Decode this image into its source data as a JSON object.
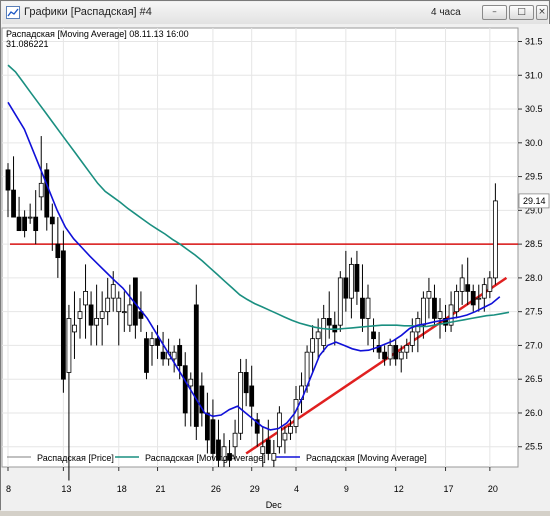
{
  "window": {
    "title": "Графики [Распадская] #4",
    "timeframe": "4 часа",
    "buttons": {
      "minimize": "–",
      "maximize": "□",
      "close": "×"
    }
  },
  "chart_info": {
    "header": "Распадская [Moving Average] 08.11.13 16:00",
    "value": "31.086221",
    "last_price": "29.14"
  },
  "legend": {
    "items": [
      {
        "label": "Распадская [Price]",
        "color": "#808080"
      },
      {
        "label": "Распадская [Moving Average]",
        "color": "#1a8f80"
      },
      {
        "label": "Распадская [Moving Average]",
        "color": "#1010d8"
      }
    ]
  },
  "chart_data": {
    "type": "candlestick",
    "x_tick_labels": [
      "8",
      "13",
      "18",
      "21",
      "26",
      "29",
      "4",
      "9",
      "12",
      "17",
      "20"
    ],
    "x_sublabel": "Dec",
    "ylim": [
      25.2,
      31.7
    ],
    "y_ticks": [
      25.5,
      26.0,
      26.5,
      27.0,
      27.5,
      28.0,
      28.5,
      29.0,
      29.5,
      30.0,
      30.5,
      31.0,
      31.5
    ],
    "horizontal_line": 28.5,
    "colors": {
      "up": "#ffffff",
      "down": "#000000",
      "ma_slow": "#1a8f80",
      "ma_fast": "#1010d8",
      "hline": "#d81010",
      "trendline": "#e02020"
    },
    "candles": [
      [
        29.6,
        29.7,
        28.9,
        29.3
      ],
      [
        29.3,
        29.8,
        28.9,
        28.9
      ],
      [
        28.9,
        29.2,
        28.8,
        28.7
      ],
      [
        28.9,
        29.0,
        28.6,
        28.7
      ],
      [
        28.9,
        29.1,
        28.8,
        28.9
      ],
      [
        28.9,
        29.3,
        28.5,
        28.7
      ],
      [
        29.2,
        30.1,
        29.0,
        29.4
      ],
      [
        29.6,
        29.7,
        28.7,
        28.9
      ],
      [
        28.9,
        29.1,
        28.4,
        28.8
      ],
      [
        28.5,
        28.9,
        28.0,
        28.3
      ],
      [
        28.4,
        28.7,
        26.3,
        26.5
      ],
      [
        26.6,
        27.6,
        25.0,
        27.4
      ],
      [
        27.2,
        27.8,
        26.8,
        27.3
      ],
      [
        27.4,
        27.7,
        27.1,
        27.5
      ],
      [
        27.6,
        28.2,
        27.1,
        27.8
      ],
      [
        27.6,
        27.8,
        27.0,
        27.3
      ],
      [
        27.3,
        27.9,
        27.0,
        27.4
      ],
      [
        27.4,
        27.8,
        27.0,
        27.5
      ],
      [
        27.5,
        28.0,
        27.3,
        27.7
      ],
      [
        27.7,
        28.1,
        27.5,
        27.9
      ],
      [
        27.5,
        27.8,
        27.0,
        27.7
      ],
      [
        27.5,
        27.8,
        27.2,
        27.5
      ],
      [
        27.3,
        27.9,
        27.2,
        27.6
      ],
      [
        28.0,
        28.0,
        27.1,
        27.3
      ],
      [
        27.5,
        27.8,
        27.2,
        27.4
      ],
      [
        27.1,
        27.2,
        26.5,
        26.6
      ],
      [
        27.0,
        27.2,
        26.7,
        27.1
      ],
      [
        27.1,
        27.3,
        26.8,
        27.0
      ],
      [
        26.9,
        27.2,
        26.7,
        26.8
      ],
      [
        26.8,
        27.1,
        26.7,
        26.9
      ],
      [
        26.8,
        27.0,
        26.6,
        26.9
      ],
      [
        27.0,
        27.1,
        26.5,
        26.7
      ],
      [
        26.7,
        26.9,
        25.8,
        26.0
      ],
      [
        26.4,
        26.6,
        25.8,
        26.5
      ],
      [
        27.6,
        27.9,
        25.6,
        25.8
      ],
      [
        26.4,
        26.6,
        25.8,
        26.0
      ],
      [
        26.0,
        26.3,
        25.4,
        25.6
      ],
      [
        25.9,
        26.2,
        25.3,
        25.4
      ],
      [
        25.6,
        25.9,
        25.2,
        25.3
      ],
      [
        25.3,
        25.7,
        25.2,
        25.5
      ],
      [
        25.4,
        25.6,
        25.2,
        25.3
      ],
      [
        25.5,
        25.9,
        25.3,
        25.7
      ],
      [
        25.7,
        26.8,
        25.6,
        26.6
      ],
      [
        26.6,
        26.8,
        26.1,
        26.3
      ],
      [
        26.4,
        26.7,
        25.8,
        26.1
      ],
      [
        25.9,
        26.0,
        25.5,
        25.7
      ],
      [
        25.4,
        25.8,
        25.2,
        25.5
      ],
      [
        25.6,
        25.9,
        25.3,
        25.4
      ],
      [
        25.3,
        25.6,
        25.2,
        25.4
      ],
      [
        25.5,
        26.1,
        25.4,
        26.0
      ],
      [
        25.6,
        25.8,
        25.4,
        25.7
      ],
      [
        25.7,
        25.9,
        25.6,
        25.8
      ],
      [
        25.8,
        26.4,
        25.7,
        26.2
      ],
      [
        26.2,
        26.6,
        26.0,
        26.4
      ],
      [
        26.4,
        27.0,
        26.3,
        26.9
      ],
      [
        26.9,
        27.3,
        26.6,
        27.1
      ],
      [
        27.1,
        27.4,
        26.8,
        27.2
      ],
      [
        27.0,
        27.6,
        26.9,
        27.4
      ],
      [
        27.4,
        27.8,
        27.1,
        27.3
      ],
      [
        27.3,
        27.5,
        27.0,
        27.2
      ],
      [
        27.3,
        28.1,
        27.2,
        28.0
      ],
      [
        28.0,
        28.4,
        27.5,
        27.7
      ],
      [
        27.7,
        28.3,
        27.4,
        28.2
      ],
      [
        28.2,
        28.4,
        27.6,
        27.8
      ],
      [
        27.7,
        28.2,
        27.2,
        27.4
      ],
      [
        27.4,
        27.9,
        27.0,
        27.7
      ],
      [
        27.2,
        27.4,
        26.9,
        27.1
      ],
      [
        27.0,
        27.2,
        26.8,
        26.9
      ],
      [
        26.9,
        27.0,
        26.7,
        26.8
      ],
      [
        26.8,
        27.1,
        26.7,
        27.0
      ],
      [
        27.0,
        27.1,
        26.7,
        26.8
      ],
      [
        26.8,
        27.0,
        26.6,
        26.9
      ],
      [
        26.9,
        27.1,
        26.8,
        27.0
      ],
      [
        27.0,
        27.4,
        26.9,
        27.2
      ],
      [
        27.2,
        27.5,
        26.9,
        27.4
      ],
      [
        27.3,
        27.8,
        27.1,
        27.7
      ],
      [
        27.7,
        28.0,
        27.4,
        27.8
      ],
      [
        27.7,
        27.9,
        27.3,
        27.4
      ],
      [
        27.4,
        27.7,
        27.1,
        27.5
      ],
      [
        27.4,
        27.6,
        27.2,
        27.3
      ],
      [
        27.3,
        27.8,
        27.2,
        27.6
      ],
      [
        27.5,
        27.9,
        27.4,
        27.8
      ],
      [
        27.8,
        28.2,
        27.6,
        28.0
      ],
      [
        27.9,
        28.3,
        27.6,
        27.8
      ],
      [
        27.8,
        27.9,
        27.5,
        27.6
      ],
      [
        27.7,
        27.9,
        27.5,
        27.7
      ],
      [
        27.7,
        28.0,
        27.5,
        27.9
      ],
      [
        27.8,
        28.1,
        27.7,
        28.0
      ],
      [
        28.0,
        29.4,
        27.9,
        29.14
      ]
    ],
    "ma_slow": [
      [
        0,
        31.15
      ],
      [
        1,
        31.05
      ],
      [
        2,
        30.9
      ],
      [
        3,
        30.75
      ],
      [
        4,
        30.6
      ],
      [
        5,
        30.45
      ],
      [
        6,
        30.3
      ],
      [
        7,
        30.15
      ],
      [
        8,
        30.0
      ],
      [
        9,
        29.85
      ],
      [
        10,
        29.7
      ],
      [
        11,
        29.55
      ],
      [
        12,
        29.4
      ],
      [
        13,
        29.28
      ],
      [
        14,
        29.2
      ],
      [
        15,
        29.12
      ],
      [
        16,
        29.03
      ],
      [
        17,
        28.95
      ],
      [
        18,
        28.87
      ],
      [
        19,
        28.79
      ],
      [
        20,
        28.72
      ],
      [
        21,
        28.65
      ],
      [
        22,
        28.57
      ],
      [
        23,
        28.5
      ],
      [
        24,
        28.42
      ],
      [
        25,
        28.34
      ],
      [
        26,
        28.25
      ],
      [
        27,
        28.15
      ],
      [
        28,
        28.05
      ],
      [
        29,
        27.95
      ],
      [
        30,
        27.85
      ],
      [
        31,
        27.75
      ],
      [
        32,
        27.68
      ],
      [
        33,
        27.62
      ],
      [
        34,
        27.57
      ],
      [
        35,
        27.52
      ],
      [
        36,
        27.47
      ],
      [
        37,
        27.42
      ],
      [
        38,
        27.37
      ],
      [
        39,
        27.33
      ],
      [
        40,
        27.3
      ],
      [
        41,
        27.27
      ],
      [
        42,
        27.25
      ],
      [
        43,
        27.24
      ],
      [
        44,
        27.24
      ],
      [
        45,
        27.25
      ],
      [
        46,
        27.26
      ],
      [
        47,
        27.27
      ],
      [
        48,
        27.28
      ],
      [
        49,
        27.29
      ],
      [
        50,
        27.3
      ],
      [
        51,
        27.3
      ],
      [
        52,
        27.3
      ],
      [
        53,
        27.29
      ],
      [
        54,
        27.29
      ],
      [
        55,
        27.28
      ],
      [
        56,
        27.28
      ],
      [
        57,
        27.3
      ],
      [
        58,
        27.32
      ],
      [
        59,
        27.34
      ],
      [
        60,
        27.36
      ],
      [
        61,
        27.38
      ],
      [
        62,
        27.4
      ],
      [
        63,
        27.42
      ],
      [
        64,
        27.44
      ],
      [
        65,
        27.45
      ],
      [
        66,
        27.47
      ],
      [
        67,
        27.49
      ]
    ],
    "ma_fast": [
      [
        0,
        30.6
      ],
      [
        1,
        30.4
      ],
      [
        2,
        30.2
      ],
      [
        3,
        29.9
      ],
      [
        4,
        29.6
      ],
      [
        5,
        29.3
      ],
      [
        6,
        29.0
      ],
      [
        7,
        28.75
      ],
      [
        8,
        28.58
      ],
      [
        9,
        28.45
      ],
      [
        10,
        28.32
      ],
      [
        11,
        28.2
      ],
      [
        12,
        28.08
      ],
      [
        13,
        27.96
      ],
      [
        14,
        27.85
      ],
      [
        15,
        27.7
      ],
      [
        16,
        27.55
      ],
      [
        17,
        27.4
      ],
      [
        18,
        27.2
      ],
      [
        19,
        27.0
      ],
      [
        20,
        26.8
      ],
      [
        21,
        26.6
      ],
      [
        22,
        26.4
      ],
      [
        23,
        26.2
      ],
      [
        24,
        26.0
      ],
      [
        25,
        25.95
      ],
      [
        26,
        25.97
      ],
      [
        27,
        26.05
      ],
      [
        28,
        26.1
      ],
      [
        29,
        26.0
      ],
      [
        30,
        25.9
      ],
      [
        31,
        25.8
      ],
      [
        32,
        25.75
      ],
      [
        33,
        25.77
      ],
      [
        34,
        25.85
      ],
      [
        35,
        26.0
      ],
      [
        36,
        26.25
      ],
      [
        37,
        26.55
      ],
      [
        38,
        26.85
      ],
      [
        39,
        27.0
      ],
      [
        40,
        27.05
      ],
      [
        41,
        27.0
      ],
      [
        42,
        26.95
      ],
      [
        43,
        26.92
      ],
      [
        44,
        26.93
      ],
      [
        45,
        26.97
      ],
      [
        46,
        27.02
      ],
      [
        47,
        27.07
      ],
      [
        48,
        27.15
      ],
      [
        49,
        27.25
      ],
      [
        50,
        27.3
      ],
      [
        51,
        27.32
      ],
      [
        52,
        27.35
      ],
      [
        53,
        27.37
      ],
      [
        54,
        27.4
      ],
      [
        55,
        27.42
      ],
      [
        56,
        27.45
      ],
      [
        57,
        27.5
      ],
      [
        58,
        27.56
      ],
      [
        59,
        27.62
      ],
      [
        60,
        27.72
      ]
    ],
    "trendline": [
      [
        43,
        25.4
      ],
      [
        90,
        28.0
      ]
    ]
  }
}
